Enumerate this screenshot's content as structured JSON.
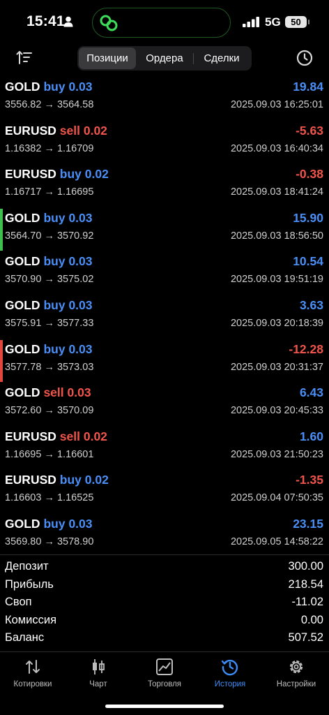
{
  "status": {
    "time": "15:41",
    "network": "5G",
    "battery": "50"
  },
  "header": {
    "tabs": [
      {
        "label": "Позиции",
        "active": true
      },
      {
        "label": "Ордера",
        "active": false
      },
      {
        "label": "Сделки",
        "active": false
      }
    ]
  },
  "deals": [
    {
      "symbol": "GOLD",
      "side": "buy",
      "volume": "0.03",
      "prices": "3556.82 → 3564.58",
      "profit": "19.84",
      "time": "2025.09.03 16:25:01",
      "marker": ""
    },
    {
      "symbol": "EURUSD",
      "side": "sell",
      "volume": "0.02",
      "prices": "1.16382 → 1.16709",
      "profit": "-5.63",
      "time": "2025.09.03 16:40:34",
      "marker": ""
    },
    {
      "symbol": "EURUSD",
      "side": "buy",
      "volume": "0.02",
      "prices": "1.16717 → 1.16695",
      "profit": "-0.38",
      "time": "2025.09.03 18:41:24",
      "marker": ""
    },
    {
      "symbol": "GOLD",
      "side": "buy",
      "volume": "0.03",
      "prices": "3564.70 → 3570.92",
      "profit": "15.90",
      "time": "2025.09.03 18:56:50",
      "marker": "#3fbf4f"
    },
    {
      "symbol": "GOLD",
      "side": "buy",
      "volume": "0.03",
      "prices": "3570.90 → 3575.02",
      "profit": "10.54",
      "time": "2025.09.03 19:51:19",
      "marker": ""
    },
    {
      "symbol": "GOLD",
      "side": "buy",
      "volume": "0.03",
      "prices": "3575.91 → 3577.33",
      "profit": "3.63",
      "time": "2025.09.03 20:18:39",
      "marker": ""
    },
    {
      "symbol": "GOLD",
      "side": "buy",
      "volume": "0.03",
      "prices": "3577.78 → 3573.03",
      "profit": "-12.28",
      "time": "2025.09.03 20:31:37",
      "marker": "#e0473d"
    },
    {
      "symbol": "GOLD",
      "side": "sell",
      "volume": "0.03",
      "prices": "3572.60 → 3570.09",
      "profit": "6.43",
      "time": "2025.09.03 20:45:33",
      "marker": ""
    },
    {
      "symbol": "EURUSD",
      "side": "sell",
      "volume": "0.02",
      "prices": "1.16695 → 1.16601",
      "profit": "1.60",
      "time": "2025.09.03 21:50:23",
      "marker": ""
    },
    {
      "symbol": "EURUSD",
      "side": "buy",
      "volume": "0.02",
      "prices": "1.16603 → 1.16525",
      "profit": "-1.35",
      "time": "2025.09.04 07:50:35",
      "marker": ""
    },
    {
      "symbol": "GOLD",
      "side": "buy",
      "volume": "0.03",
      "prices": "3569.80 → 3578.90",
      "profit": "23.15",
      "time": "2025.09.05 14:58:22",
      "marker": ""
    }
  ],
  "summary": [
    {
      "label": "Депозит",
      "value": "300.00"
    },
    {
      "label": "Прибыль",
      "value": "218.54"
    },
    {
      "label": "Своп",
      "value": "-11.02"
    },
    {
      "label": "Комиссия",
      "value": "0.00"
    },
    {
      "label": "Баланс",
      "value": "507.52"
    }
  ],
  "tabbar": [
    {
      "label": "Котировки",
      "icon": "quotes-icon",
      "active": false
    },
    {
      "label": "Чарт",
      "icon": "chart-icon",
      "active": false
    },
    {
      "label": "Торговля",
      "icon": "trade-icon",
      "active": false
    },
    {
      "label": "История",
      "icon": "history-icon",
      "active": true
    },
    {
      "label": "Настройки",
      "icon": "settings-icon",
      "active": false
    }
  ],
  "colors": {
    "buy": "#4a8ff7",
    "sell": "#f0544a",
    "active_tab": "#3d8bf5"
  }
}
